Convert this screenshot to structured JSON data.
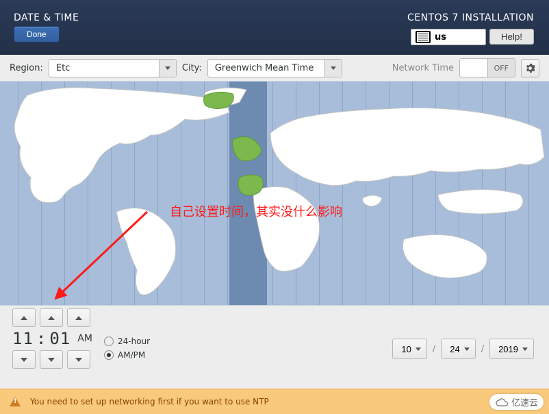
{
  "header": {
    "page_title": "DATE & TIME",
    "installer_title": "CENTOS 7 INSTALLATION",
    "done_label": "Done",
    "help_label": "Help!",
    "keyboard_layout": "us"
  },
  "toolbar": {
    "region_label": "Region:",
    "region_value": "Etc",
    "city_label": "City:",
    "city_value": "Greenwich Mean Time",
    "network_time_label": "Network Time",
    "network_time_state": "OFF"
  },
  "time": {
    "hours": "11",
    "minutes": "01",
    "ampm": "AM",
    "format_24h_label": "24-hour",
    "format_ampm_label": "AM/PM",
    "selected_format": "ampm"
  },
  "date": {
    "day": "10",
    "month": "24",
    "year": "2019",
    "separator": "/"
  },
  "annotation": "自己设置时间，其实没什么影响",
  "status": {
    "warning": "You need to set up networking first if you want to use NTP"
  },
  "watermark": "亿速云"
}
